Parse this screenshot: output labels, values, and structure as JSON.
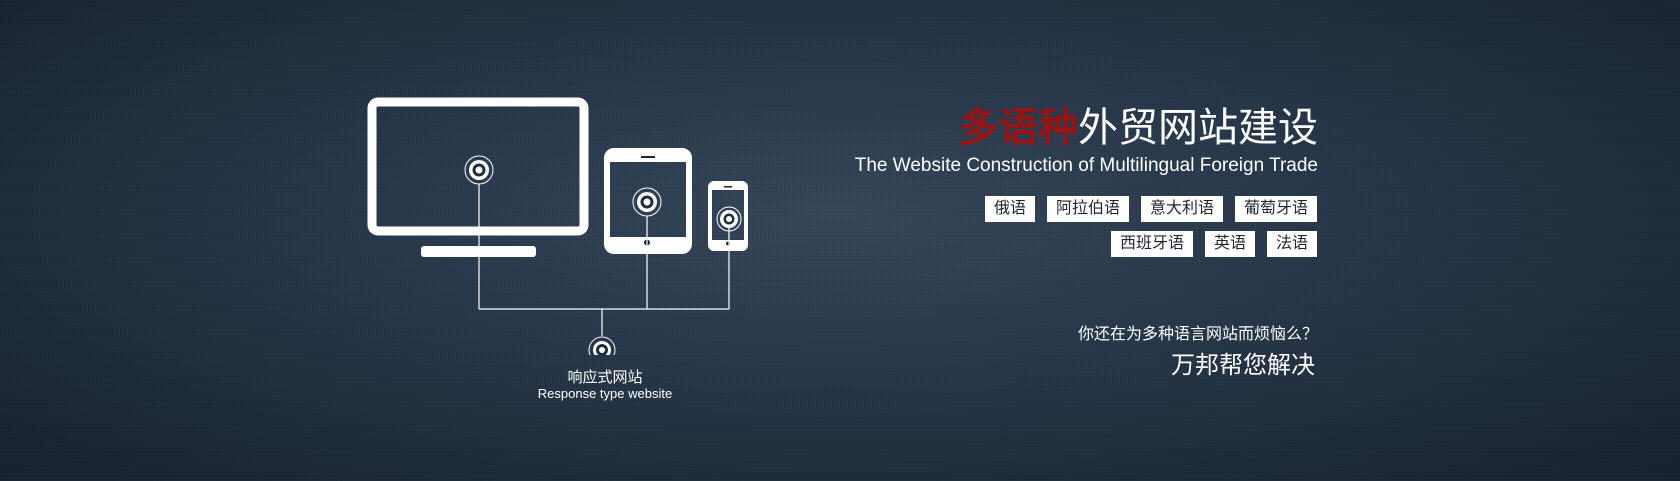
{
  "colors": {
    "background": "#27374a",
    "accent_red": "#9a1313",
    "text": "#ffffff"
  },
  "devices_graphic": {
    "icons": [
      "monitor-icon",
      "tablet-icon",
      "phone-icon",
      "target-icon"
    ]
  },
  "responsive": {
    "label_cn": "响应式网站",
    "label_en": "Response type website"
  },
  "headline": {
    "highlight": "多语种",
    "rest": "外贸网站建设"
  },
  "subtitle": "The Website Construction of Multilingual Foreign Trade",
  "languages": {
    "row1": [
      "俄语",
      "阿拉伯语",
      "意大利语",
      "葡萄牙语"
    ],
    "row2": [
      "西班牙语",
      "英语",
      "法语"
    ]
  },
  "question": "你还在为多种语言网站而烦恼么？",
  "answer": "万邦帮您解决"
}
